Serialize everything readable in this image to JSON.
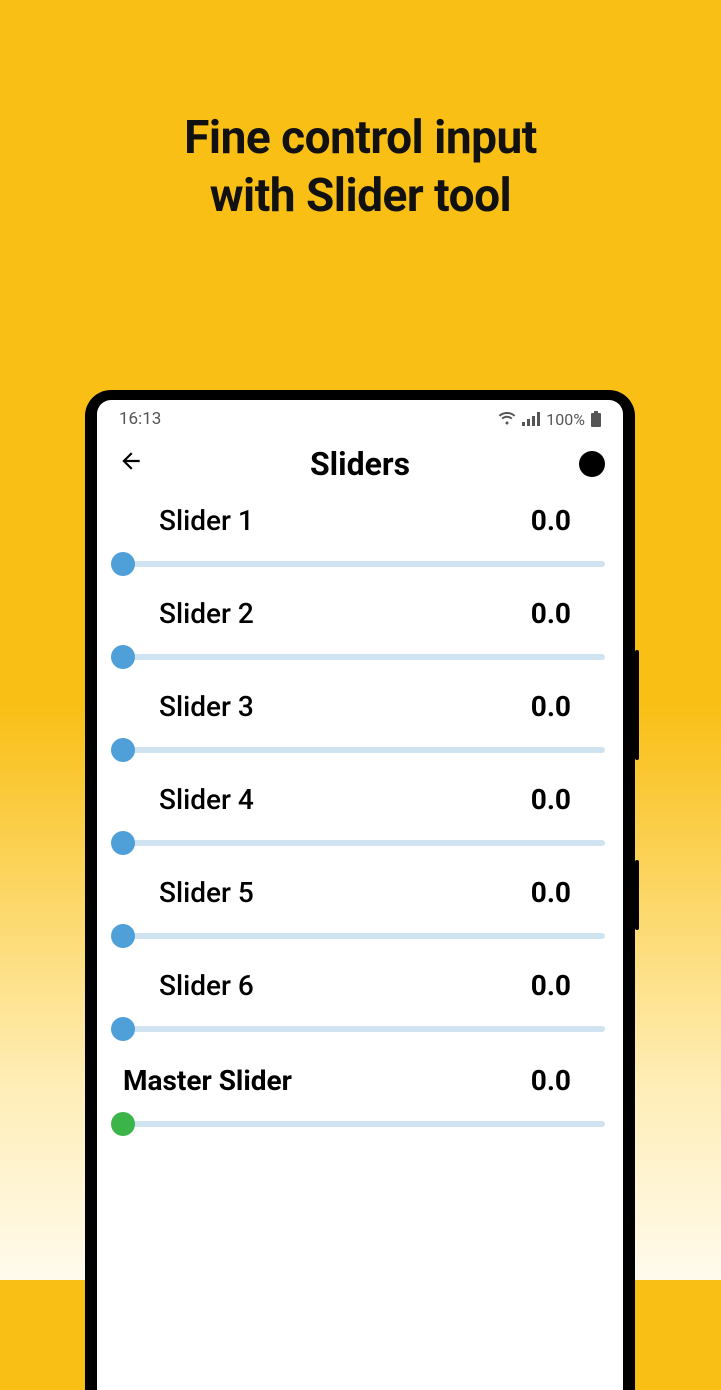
{
  "headline": {
    "line1": "Fine control input",
    "line2": "with Slider tool"
  },
  "status": {
    "time": "16:13",
    "battery_pct": "100%"
  },
  "app": {
    "title": "Sliders"
  },
  "sliders": [
    {
      "name": "Slider 1",
      "value": "0.0"
    },
    {
      "name": "Slider 2",
      "value": "0.0"
    },
    {
      "name": "Slider 3",
      "value": "0.0"
    },
    {
      "name": "Slider 4",
      "value": "0.0"
    },
    {
      "name": "Slider 5",
      "value": "0.0"
    },
    {
      "name": "Slider 6",
      "value": "0.0"
    }
  ],
  "master": {
    "name": "Master Slider",
    "value": "0.0"
  }
}
